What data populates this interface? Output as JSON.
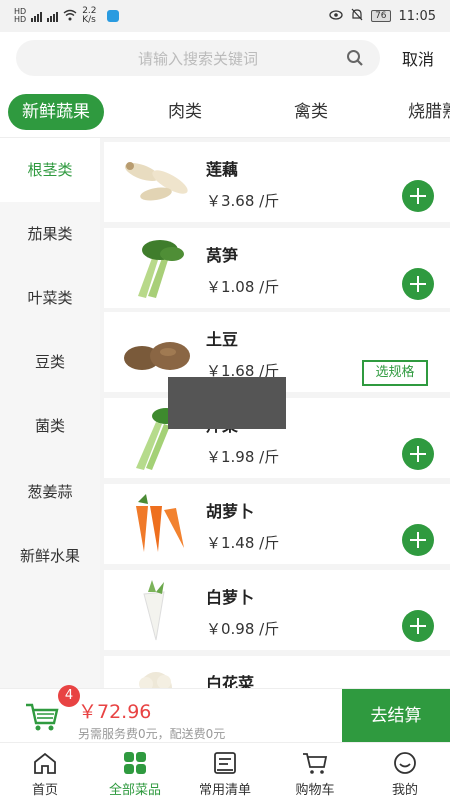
{
  "status": {
    "left_text": "HD 4G 4G",
    "speed": "2.2 K/s",
    "battery": "76",
    "time": "11:05"
  },
  "search": {
    "placeholder": "请输入搜索关键词",
    "cancel_label": "取消"
  },
  "tabs": [
    "新鲜蔬果",
    "肉类",
    "禽类",
    "烧腊熟食"
  ],
  "sidebar": {
    "items": [
      "根茎类",
      "茄果类",
      "叶菜类",
      "豆类",
      "菌类",
      "葱姜蒜",
      "新鲜水果"
    ]
  },
  "products": [
    {
      "name": "莲藕",
      "price": "￥3.68 /斤",
      "action": "add"
    },
    {
      "name": "莴笋",
      "price": "￥1.08 /斤",
      "action": "add"
    },
    {
      "name": "土豆",
      "price": "￥1.68 /斤",
      "action": "spec",
      "spec_label": "选规格"
    },
    {
      "name": "芹菜",
      "price": "￥1.98 /斤",
      "action": "add"
    },
    {
      "name": "胡萝卜",
      "price": "￥1.48 /斤",
      "action": "add"
    },
    {
      "name": "白萝卜",
      "price": "￥0.98 /斤",
      "action": "add"
    },
    {
      "name": "白花菜",
      "price": "",
      "action": "add"
    }
  ],
  "cart": {
    "count": "4",
    "total": "￥72.96",
    "note": "另需服务费0元，配送费0元",
    "checkout_label": "去结算"
  },
  "nav": {
    "items": [
      "首页",
      "全部菜品",
      "常用清单",
      "购物车",
      "我的"
    ]
  },
  "colors": {
    "accent": "#2f9a3f",
    "price_red": "#e84343"
  }
}
